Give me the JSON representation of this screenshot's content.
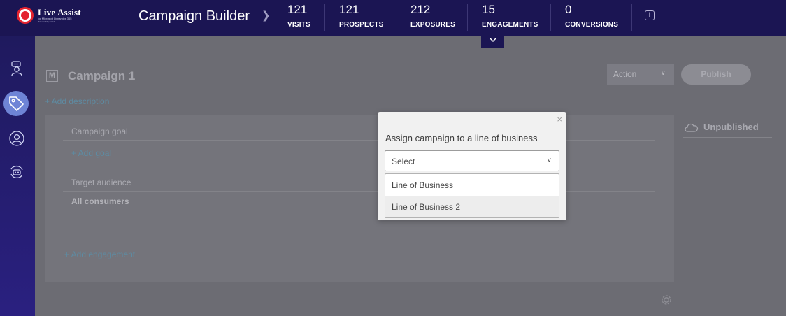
{
  "header": {
    "logo_title": "Live Assist",
    "logo_sub": "for Microsoft Dynamics 365",
    "logo_sub2": "Powered by CafeX",
    "app_title": "Campaign Builder",
    "stats": [
      {
        "value": "121",
        "label": "VISITS"
      },
      {
        "value": "121",
        "label": "PROSPECTS"
      },
      {
        "value": "212",
        "label": "EXPOSURES"
      },
      {
        "value": "15",
        "label": "ENGAGEMENTS"
      },
      {
        "value": "0",
        "label": "CONVERSIONS"
      }
    ],
    "info_icon": "i"
  },
  "sidebar": {
    "items": [
      {
        "icon": "agent-chat-icon",
        "active": false
      },
      {
        "icon": "tag-icon",
        "active": true
      },
      {
        "icon": "user-icon",
        "active": false
      },
      {
        "icon": "bot-sync-icon",
        "active": false
      }
    ]
  },
  "campaign": {
    "badge": "M",
    "name": "Campaign 1",
    "action_label": "Action",
    "publish_label": "Publish",
    "add_description": "+ Add description",
    "goal_label": "Campaign goal",
    "add_goal": "+  Add goal",
    "audience_label": "Target audience",
    "audience_value": "All consumers",
    "add_engagement": "+   Add engagement",
    "status": "Unpublished"
  },
  "modal": {
    "title": "Assign campaign to a line of business",
    "close": "×",
    "select_placeholder": "Select",
    "options": [
      "Line of Business",
      "Line of Business 2"
    ]
  },
  "colors": {
    "topbar": "#1b1553",
    "accent_link": "#5e8ba2",
    "active_nav": "#6e84d6"
  }
}
